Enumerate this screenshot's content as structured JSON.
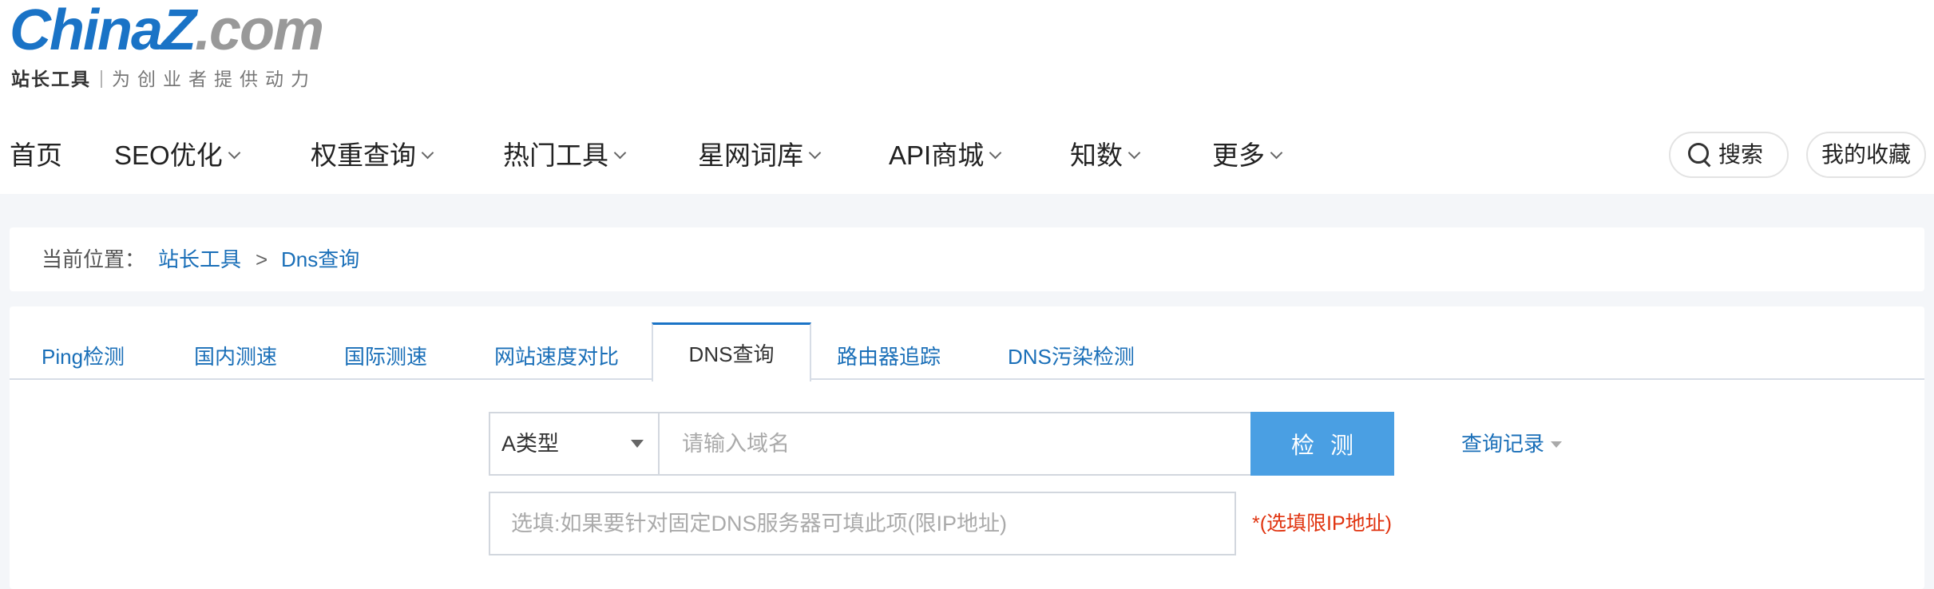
{
  "logo": {
    "brand": "ChinaZ",
    "domain": ".com",
    "tagline_bold": "站长工具",
    "tagline": "为创业者提供动力"
  },
  "nav": {
    "items": [
      {
        "label": "首页",
        "dropdown": false
      },
      {
        "label": "SEO优化",
        "dropdown": true
      },
      {
        "label": "权重查询",
        "dropdown": true
      },
      {
        "label": "热门工具",
        "dropdown": true
      },
      {
        "label": "星网词库",
        "dropdown": true
      },
      {
        "label": "API商城",
        "dropdown": true
      },
      {
        "label": "知数",
        "dropdown": true
      },
      {
        "label": "更多",
        "dropdown": true
      }
    ],
    "search_label": "搜索",
    "favorites_label": "我的收藏"
  },
  "breadcrumb": {
    "label": "当前位置：",
    "items": [
      "站长工具",
      "Dns查询"
    ],
    "separator": ">"
  },
  "tabs": {
    "active": 4,
    "items": [
      "Ping检测",
      "国内测速",
      "国际测速",
      "网站速度对比",
      "DNS查询",
      "路由器追踪",
      "DNS污染检测"
    ]
  },
  "form": {
    "type_select": "A类型",
    "domain_placeholder": "请输入域名",
    "detect_button": "检测",
    "history_link": "查询记录",
    "dns_placeholder": "选填:如果要针对固定DNS服务器可填此项(限IP地址)",
    "dns_note": "*(选填限IP地址)"
  },
  "colors": {
    "brand_blue": "#1a73c6",
    "link_blue": "#1a6fb8",
    "button_blue": "#4a9fe3",
    "warning_red": "#e0330f"
  }
}
